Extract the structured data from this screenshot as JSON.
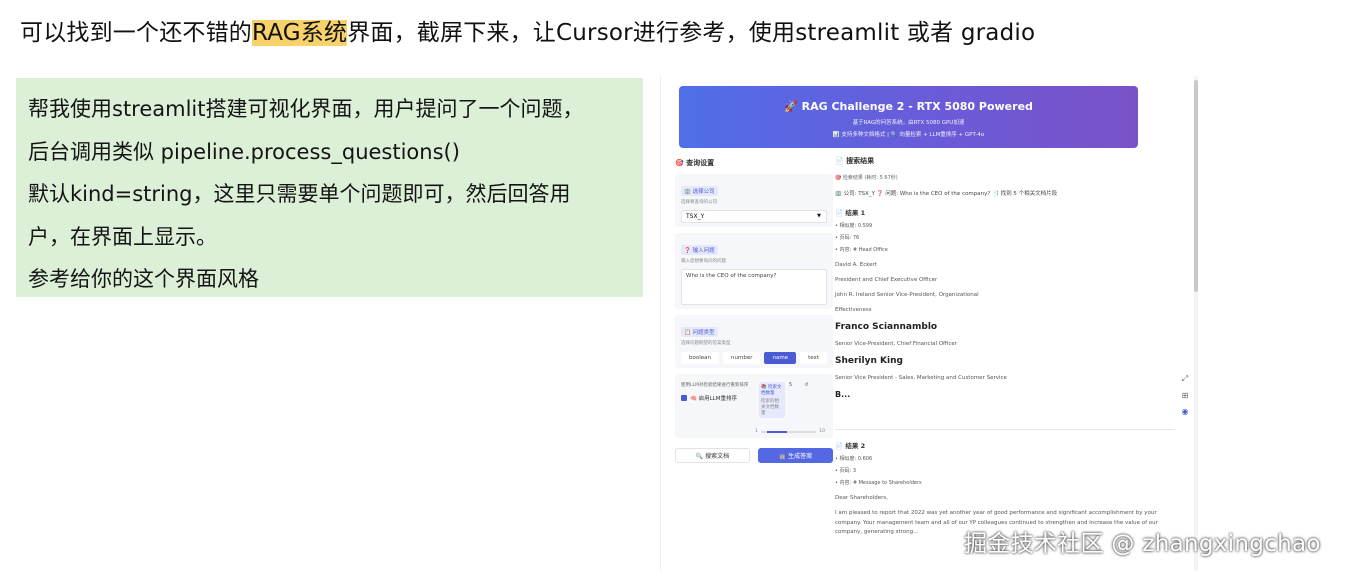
{
  "heading": {
    "part1": "可以找到一个还不错的",
    "highlight": "RAG系统",
    "part2": "界面，截屏下来，让Cursor进行参考，使用streamlit 或者 gradio"
  },
  "note": {
    "lines": [
      "帮我使用streamlit搭建可视化界面，用户提问了一个问题，",
      "后台调用类似 pipeline.process_questions()",
      "默认kind=string，这里只需要单个问题即可，然后回答用",
      "户，在界面上显示。",
      "参考给你的这个界面风格"
    ]
  },
  "screenshot": {
    "banner": {
      "title": "🚀 RAG Challenge 2 - RTX 5080 Powered",
      "subtitle": "基于RAG的问答系统，由RTX 5080 GPU加速",
      "subtitle2": "📊 支持多种文档格式 | 🔍 向量检索 + LLM重排序 + GPT-4o"
    },
    "sidebar": {
      "title": "🎯 查询设置",
      "company_chip": "🏢 选择公司",
      "company_hint": "选择要查询的公司",
      "company_value": "TSX_Y",
      "question_chip": "❓ 输入问题",
      "question_hint": "输入您想要询问的问题",
      "question_value": "Who is the CEO of the company?",
      "type_chip": "📋 问题类型",
      "type_hint": "选择问题期望的答案类型",
      "types": [
        "boolean",
        "number",
        "name",
        "text"
      ],
      "active_type": "name",
      "llm_hint": "使用LLM对检索结果进行重新排序",
      "rerank_label": "🧠 启用LLM重排序",
      "topk_chip": "📚 检索文档数量",
      "topk_hint": "检索的相关文档数量",
      "topk_value": "5",
      "slider_min": "1",
      "slider_max": "10",
      "search_button": "🔍 搜索文档",
      "generate_button": "🤖 生成答案"
    },
    "results": {
      "title": "📄 搜索结果",
      "timing": "🎯 检索结果 (耗时: 5.67秒)",
      "meta": "🏢 公司: TSX_Y  ❓ 问题: Who is the CEO of the company?  📑 找到 5 个相关文档片段",
      "r1_head": "📄 结果 1",
      "r1_score": "• 相似度: 0.599",
      "r1_page": "• 页码: 76",
      "r1_content": "• 内容: # Head Office",
      "r1_lines": [
        "David A. Eckert",
        "President and Chief Executive Officer",
        "John R. Ireland Senior Vice-President, Organizational",
        "Effectiveness"
      ],
      "name1": "Franco Sciannamblo",
      "role1": "Senior Vice-President, Chief Financial Officer",
      "name2": "Sherilyn King",
      "role2": "Senior Vice President - Sales, Marketing and Customer Service",
      "trunc": "B...",
      "r2_head": "📄 结果 2",
      "r2_score": "• 相似度: 0.606",
      "r2_page": "• 页码: 3",
      "r2_content": "• 内容: # Message to Shareholders",
      "r2_greeting": "Dear Shareholders,",
      "r2_para": "I am pleased to report that 2022 was yet another year of good performance and significant accomplishment by your company. Your management team and all of our YP colleagues continued to strengthen and increase the value of our company, generating strong..."
    }
  },
  "watermark": "掘金技术社区 @ zhangxingchao"
}
